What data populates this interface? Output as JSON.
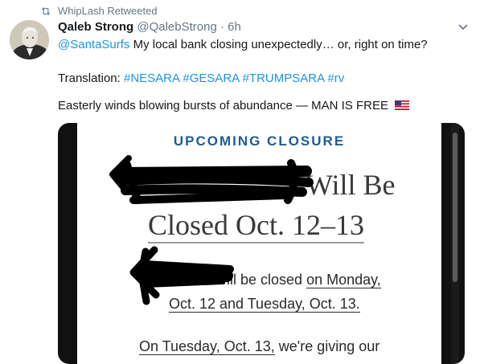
{
  "retweet": {
    "icon": "retweet-icon",
    "label": "WhipLash Retweeted"
  },
  "author": {
    "name": "Qaleb Strong",
    "handle": "@QalebStrong",
    "separator": " · ",
    "time": "6h"
  },
  "tweet": {
    "line1_mention": "@SantaSurfs",
    "line1_text": " My local bank closing unexpectedly… or, right on time?",
    "line2_prefix": "Translation: ",
    "hashtags": [
      "#NESARA",
      "#GESARA",
      "#TRUMPSARA",
      "#rv"
    ],
    "line3_text": "Easterly winds blowing bursts of abundance — MAN IS FREE",
    "flag_icon": "us-flag-icon"
  },
  "image": {
    "heading": "UPCOMING CLOSURE",
    "will_be": "Will Be",
    "closed_dates": "Closed Oct. 12–13",
    "body_line1_plain": "will be closed ",
    "body_line1_underlined": "on Monday,",
    "body_line2_underlined": "Oct. 12 and Tuesday, Oct. 13.",
    "body_line3_underlined": "On Tuesday, Oct. 13,",
    "body_line3_plain": " we're giving our"
  },
  "colors": {
    "link": "#1b95e0",
    "muted": "#657786",
    "heading_blue": "#1d5d91"
  }
}
